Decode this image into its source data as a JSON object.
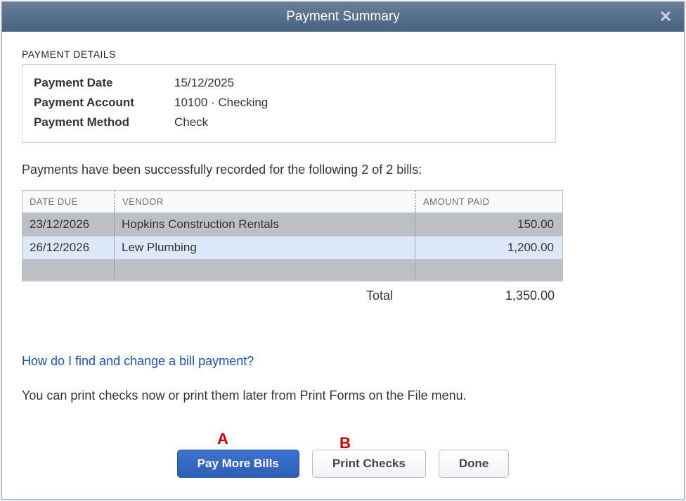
{
  "window": {
    "title": "Payment Summary"
  },
  "details": {
    "section_label": "PAYMENT DETAILS",
    "rows": [
      {
        "label": "Payment Date",
        "value": "15/12/2025"
      },
      {
        "label": "Payment Account",
        "value": "10100 · Checking"
      },
      {
        "label": "Payment Method",
        "value": "Check"
      }
    ]
  },
  "status_line": "Payments have been successfully recorded for the following 2 of 2 bills:",
  "grid": {
    "headers": {
      "date_due": "DATE DUE",
      "vendor": "VENDOR",
      "amount_paid": "AMOUNT PAID"
    },
    "rows": [
      {
        "date_due": "23/12/2026",
        "vendor": "Hopkins Construction Rentals",
        "amount_paid": "150.00"
      },
      {
        "date_due": "26/12/2026",
        "vendor": "Lew Plumbing",
        "amount_paid": "1,200.00"
      }
    ],
    "total_label": "Total",
    "total_value": "1,350.00"
  },
  "help_link": "How do I find and change a bill payment?",
  "print_note": "You can print checks now or print them later from Print Forms on the File menu.",
  "annotations": {
    "a": "A",
    "b": "B"
  },
  "buttons": {
    "pay_more_bills": "Pay More Bills",
    "print_checks": "Print Checks",
    "done": "Done"
  }
}
